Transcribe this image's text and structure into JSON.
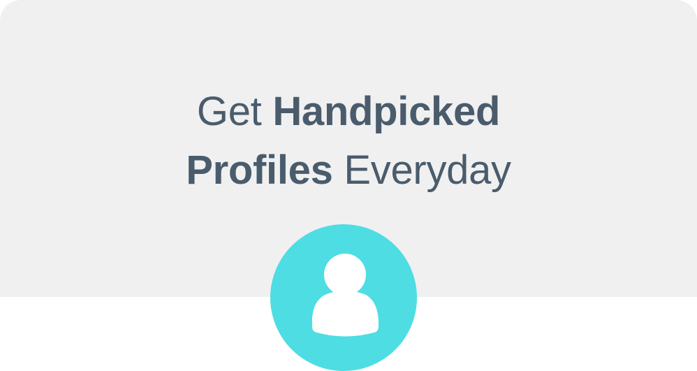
{
  "promo": {
    "headline": {
      "line1_regular": "Get",
      "line1_bold": "Handpicked",
      "line2_bold": "Profiles",
      "line2_regular": "Everyday"
    },
    "icon": "user-profile-icon",
    "colors": {
      "panel_background": "#f0f0f1",
      "headline_text": "#4a5c6c",
      "badge_accent": "#4ddde3",
      "icon_fill": "#ffffff"
    }
  }
}
